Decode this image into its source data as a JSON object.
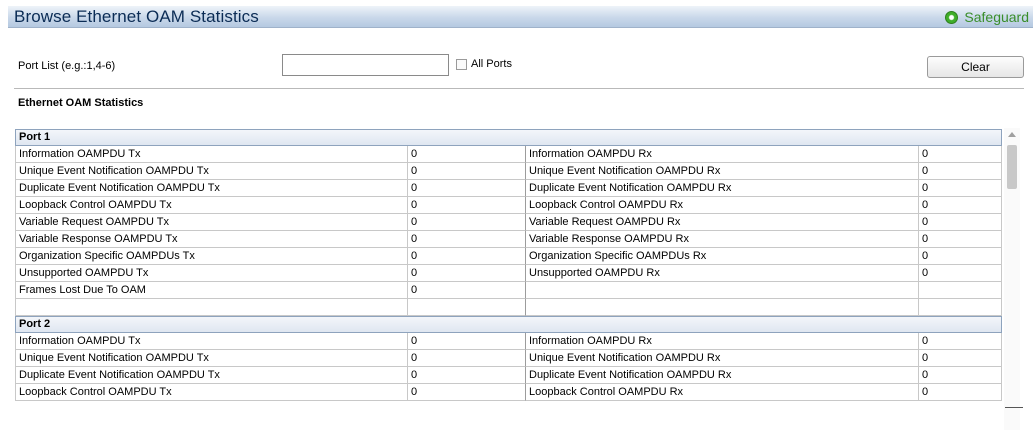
{
  "header": {
    "title": "Browse Ethernet OAM Statistics",
    "safeguard_label": "Safeguard",
    "safeguard_icon": "status-dot-icon",
    "safeguard_color": "#3fae2a"
  },
  "filter": {
    "port_list_label": "Port List (e.g.:1,4-6)",
    "port_list_value": "",
    "all_ports_label": "All Ports",
    "clear_label": "Clear"
  },
  "section_title": "Ethernet OAM Statistics",
  "ports": [
    {
      "header": "Port 1",
      "rows": [
        {
          "tx_label": "Information OAMPDU Tx",
          "tx_value": "0",
          "rx_label": "Information OAMPDU Rx",
          "rx_value": "0"
        },
        {
          "tx_label": "Unique Event Notification OAMPDU Tx",
          "tx_value": "0",
          "rx_label": "Unique Event Notification OAMPDU Rx",
          "rx_value": "0"
        },
        {
          "tx_label": "Duplicate Event Notification OAMPDU Tx",
          "tx_value": "0",
          "rx_label": "Duplicate Event Notification OAMPDU Rx",
          "rx_value": "0"
        },
        {
          "tx_label": "Loopback Control OAMPDU Tx",
          "tx_value": "0",
          "rx_label": "Loopback Control OAMPDU Rx",
          "rx_value": "0"
        },
        {
          "tx_label": "Variable Request OAMPDU Tx",
          "tx_value": "0",
          "rx_label": "Variable Request OAMPDU Rx",
          "rx_value": "0"
        },
        {
          "tx_label": "Variable Response OAMPDU Tx",
          "tx_value": "0",
          "rx_label": "Variable Response OAMPDU Rx",
          "rx_value": "0"
        },
        {
          "tx_label": "Organization Specific OAMPDUs Tx",
          "tx_value": "0",
          "rx_label": "Organization Specific OAMPDUs Rx",
          "rx_value": "0"
        },
        {
          "tx_label": "Unsupported OAMPDU Tx",
          "tx_value": "0",
          "rx_label": "Unsupported OAMPDU Rx",
          "rx_value": "0"
        },
        {
          "tx_label": "Frames Lost Due To OAM",
          "tx_value": "0",
          "rx_label": "",
          "rx_value": ""
        },
        {
          "tx_label": "",
          "tx_value": "",
          "rx_label": "",
          "rx_value": ""
        }
      ]
    },
    {
      "header": "Port 2",
      "rows": [
        {
          "tx_label": "Information OAMPDU Tx",
          "tx_value": "0",
          "rx_label": "Information OAMPDU Rx",
          "rx_value": "0"
        },
        {
          "tx_label": "Unique Event Notification OAMPDU Tx",
          "tx_value": "0",
          "rx_label": "Unique Event Notification OAMPDU Rx",
          "rx_value": "0"
        },
        {
          "tx_label": "Duplicate Event Notification OAMPDU Tx",
          "tx_value": "0",
          "rx_label": "Duplicate Event Notification OAMPDU Rx",
          "rx_value": "0"
        },
        {
          "tx_label": "Loopback Control OAMPDU Tx",
          "tx_value": "0",
          "rx_label": "Loopback Control OAMPDU Rx",
          "rx_value": "0"
        }
      ]
    }
  ]
}
